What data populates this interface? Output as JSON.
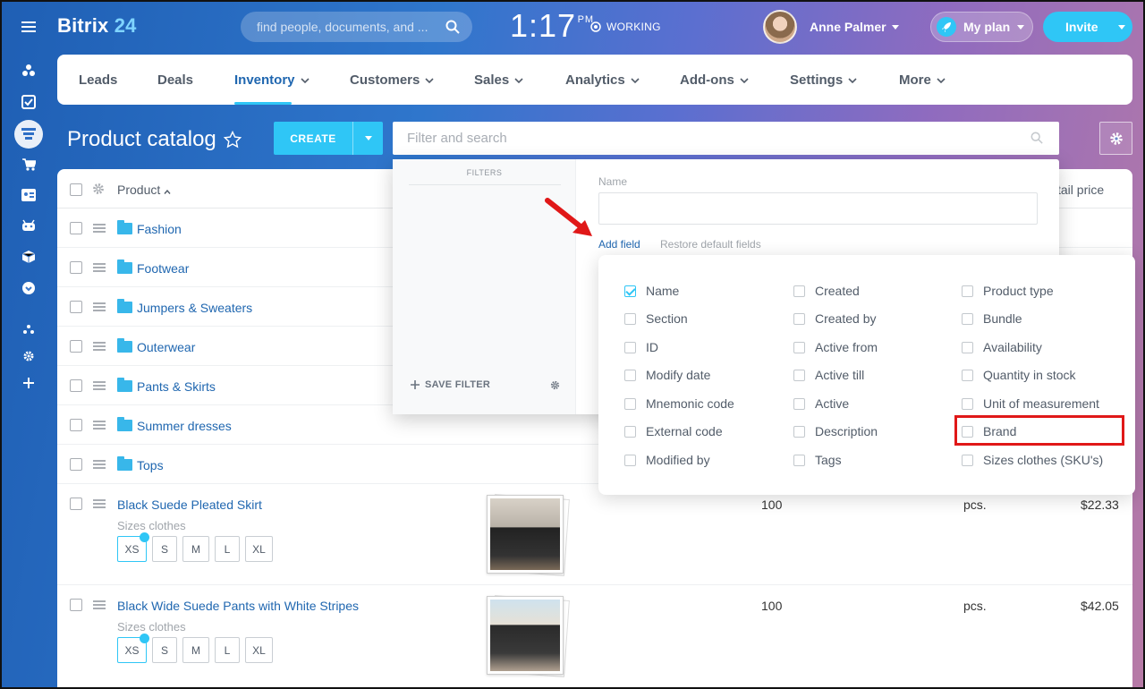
{
  "app": {
    "logo_text": "Bitrix",
    "logo_num": "24",
    "search_placeholder": "find people, documents, and ...",
    "clock": "1:17",
    "clock_suffix": "PM",
    "work_status": "WORKING",
    "user_name": "Anne Palmer",
    "plan_label": "My plan",
    "invite_label": "Invite"
  },
  "left_rail": [
    "menu-icon",
    "sites-icon",
    "tasks-icon",
    "inventory-icon",
    "cart-icon",
    "contacts-icon",
    "robot-icon",
    "box-icon",
    "more-icon",
    "structure-icon",
    "settings-icon",
    "add-icon"
  ],
  "nav": {
    "items": [
      {
        "label": "Leads",
        "dropdown": false
      },
      {
        "label": "Deals",
        "dropdown": false
      },
      {
        "label": "Inventory",
        "dropdown": true,
        "active": true
      },
      {
        "label": "Customers",
        "dropdown": true
      },
      {
        "label": "Sales",
        "dropdown": true
      },
      {
        "label": "Analytics",
        "dropdown": true
      },
      {
        "label": "Add-ons",
        "dropdown": true
      },
      {
        "label": "Settings",
        "dropdown": true
      },
      {
        "label": "More",
        "dropdown": true
      }
    ]
  },
  "page": {
    "title": "Product catalog",
    "create_label": "CREATE",
    "filter_placeholder": "Filter and search"
  },
  "grid": {
    "header_product": "Product",
    "header_price": "tail price",
    "folders": [
      "Fashion",
      "Footwear",
      "Jumpers & Sweaters",
      "Outerwear",
      "Pants & Skirts",
      "Summer dresses",
      "Tops"
    ],
    "products": [
      {
        "name": "Black Suede Pleated Skirt",
        "sizes_label": "Sizes clothes",
        "sizes": [
          "XS",
          "S",
          "M",
          "L",
          "XL"
        ],
        "selected": "XS",
        "quantity": "100",
        "unit": "pcs.",
        "price": "$22.33"
      },
      {
        "name": "Black Wide Suede Pants with White Stripes",
        "sizes_label": "Sizes clothes",
        "sizes": [
          "XS",
          "S",
          "M",
          "L",
          "XL"
        ],
        "selected": "XS",
        "quantity": "100",
        "unit": "pcs.",
        "price": "$42.05"
      }
    ]
  },
  "filter_popup": {
    "filters_heading": "FILTERS",
    "save_filter": "SAVE FILTER",
    "name_label": "Name",
    "add_field": "Add field",
    "restore": "Restore default fields"
  },
  "field_options": {
    "col1": [
      {
        "label": "Name",
        "checked": true
      },
      {
        "label": "Section",
        "checked": false
      },
      {
        "label": "ID",
        "checked": false
      },
      {
        "label": "Modify date",
        "checked": false
      },
      {
        "label": "Mnemonic code",
        "checked": false
      },
      {
        "label": "External code",
        "checked": false
      },
      {
        "label": "Modified by",
        "checked": false
      }
    ],
    "col2": [
      {
        "label": "Created",
        "checked": false
      },
      {
        "label": "Created by",
        "checked": false
      },
      {
        "label": "Active from",
        "checked": false
      },
      {
        "label": "Active till",
        "checked": false
      },
      {
        "label": "Active",
        "checked": false
      },
      {
        "label": "Description",
        "checked": false
      },
      {
        "label": "Tags",
        "checked": false
      }
    ],
    "col3": [
      {
        "label": "Product type",
        "checked": false
      },
      {
        "label": "Bundle",
        "checked": false
      },
      {
        "label": "Availability",
        "checked": false
      },
      {
        "label": "Quantity in stock",
        "checked": false
      },
      {
        "label": "Unit of measurement",
        "checked": false
      },
      {
        "label": "Brand",
        "checked": false
      },
      {
        "label": "Sizes clothes (SKU's)",
        "checked": false
      }
    ]
  },
  "colors": {
    "accent": "#2fc6f6",
    "link": "#2067b0",
    "highlight": "#e01818"
  }
}
